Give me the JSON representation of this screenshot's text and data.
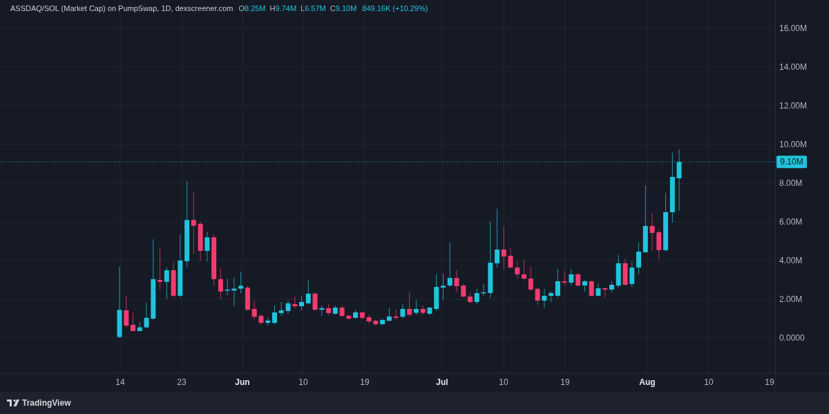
{
  "header": {
    "title": "ASSDAQ/SOL (Market Cap) on PumpSwap, 1D, dexscreener.com",
    "ohlc": [
      {
        "label": "O",
        "value": "8.25M"
      },
      {
        "label": "H",
        "value": "9.74M"
      },
      {
        "label": "L",
        "value": "6.57M"
      },
      {
        "label": "C",
        "value": "9.10M"
      }
    ],
    "change": "849.16K (+10.29%)"
  },
  "chart": {
    "price_axis": {
      "labels": [
        "16.00M",
        "14.00M",
        "12.00M",
        "10.00M",
        "8.00M",
        "6.00M",
        "4.00M",
        "2.00M",
        "0.0000"
      ]
    },
    "time_axis": {
      "labels": [
        "14",
        "23",
        "Jun",
        "10",
        "19",
        "Jul",
        "10",
        "19",
        "Aug",
        "10",
        "19"
      ]
    },
    "last_price": {
      "label": "9.10M"
    }
  },
  "footer": {
    "brand": "TradingView"
  }
}
